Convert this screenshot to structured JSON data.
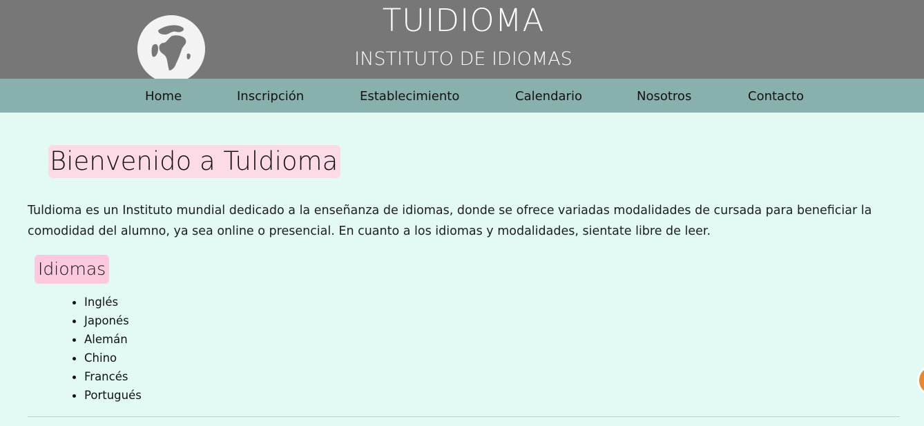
{
  "header": {
    "title": "TUIDIOMA",
    "subtitle": "INSTITUTO DE IDIOMAS",
    "logo_icon": "globe-icon"
  },
  "nav": {
    "items": [
      {
        "label": "Home"
      },
      {
        "label": "Inscripción"
      },
      {
        "label": "Establecimiento"
      },
      {
        "label": "Calendario"
      },
      {
        "label": "Nosotros"
      },
      {
        "label": "Contacto"
      }
    ]
  },
  "main": {
    "welcome": "Bienvenido a Tuldioma",
    "intro": "Tuldioma es un Instituto mundial dedicado a la enseñanza de idiomas, donde se ofrece variadas modalidades de cursada para beneficiar la comodidad del alumno, ya sea online o presencial. En cuanto a los idiomas y modalidades, sientate libre de leer.",
    "languages_title": "Idiomas",
    "languages": [
      "Inglés",
      "Japonés",
      "Alemán",
      "Chino",
      "Francés",
      "Portugués"
    ]
  },
  "colors": {
    "header_bg": "#777777",
    "nav_bg": "#88b1ad",
    "page_bg": "#e2faf3",
    "welcome_highlight": "#fddbe6",
    "section_highlight": "#fcc9de"
  }
}
